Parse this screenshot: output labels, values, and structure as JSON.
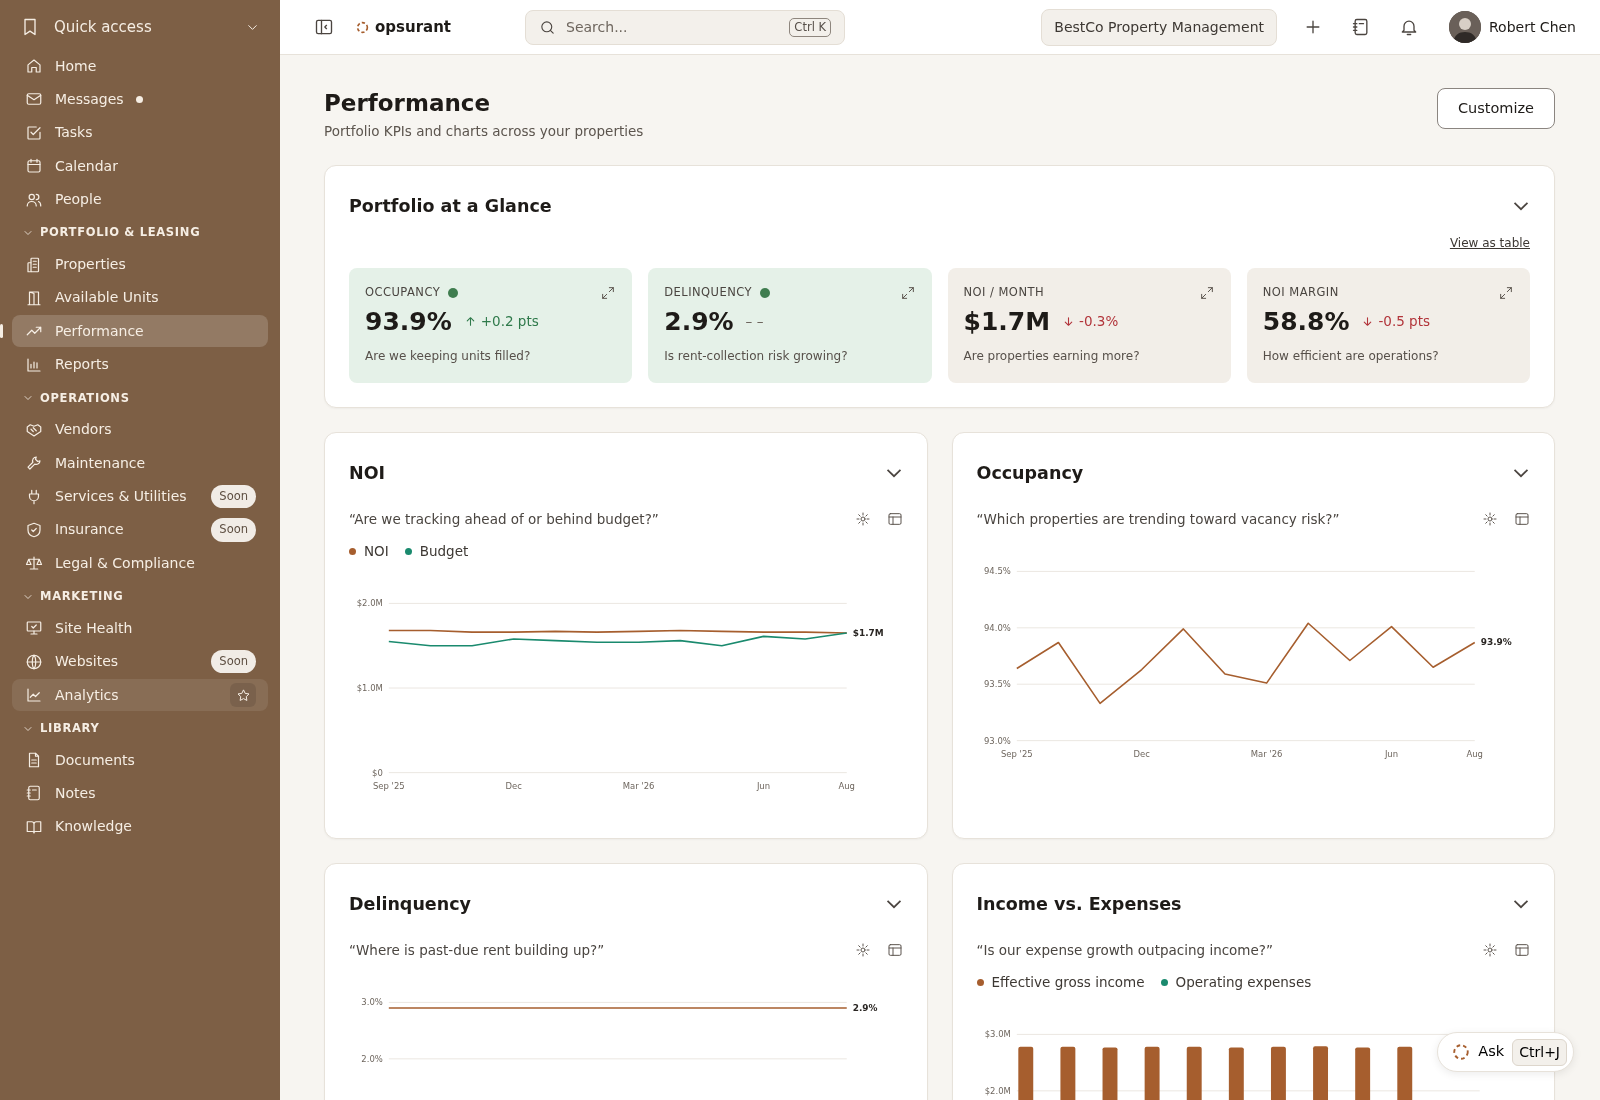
{
  "sidebar": {
    "groups": [
      {
        "kind": "quick",
        "title": "Quick access",
        "expanded": true,
        "items": [
          {
            "label": "Home",
            "selected": false
          },
          {
            "label": "Messages",
            "selected": false,
            "unread": true
          },
          {
            "label": "Tasks",
            "selected": false
          },
          {
            "label": "Calendar",
            "selected": false
          },
          {
            "label": "People",
            "selected": false
          }
        ]
      },
      {
        "kind": "section",
        "title": "PORTFOLIO & LEASING",
        "expanded": true,
        "items": [
          {
            "label": "Properties",
            "selected": false
          },
          {
            "label": "Available Units",
            "selected": false
          },
          {
            "label": "Performance",
            "selected": true
          },
          {
            "label": "Reports",
            "selected": false
          }
        ]
      },
      {
        "kind": "section",
        "title": "OPERATIONS",
        "expanded": true,
        "items": [
          {
            "label": "Vendors",
            "selected": false
          },
          {
            "label": "Maintenance",
            "selected": false
          },
          {
            "label": "Services & Utilities",
            "selected": false,
            "badge": "Soon"
          },
          {
            "label": "Insurance",
            "selected": false,
            "badge": "Soon"
          },
          {
            "label": "Legal & Compliance",
            "selected": false
          }
        ]
      },
      {
        "kind": "section",
        "title": "MARKETING",
        "expanded": true,
        "items": [
          {
            "label": "Site Health",
            "selected": false
          },
          {
            "label": "Websites",
            "selected": false,
            "badge": "Soon"
          },
          {
            "label": "Analytics",
            "selected": false,
            "hovered": true,
            "pinned": false
          }
        ]
      },
      {
        "kind": "section",
        "title": "LIBRARY",
        "expanded": true,
        "items": [
          {
            "label": "Documents",
            "selected": false
          },
          {
            "label": "Notes",
            "selected": false
          },
          {
            "label": "Knowledge",
            "selected": false
          }
        ]
      }
    ]
  },
  "topbar": {
    "brand": "opsurant",
    "search": {
      "placeholder": "Search...",
      "shortcut": "Ctrl K"
    },
    "organization": "BestCo Property Management",
    "user": {
      "name": "Robert Chen"
    }
  },
  "page": {
    "title": "Performance",
    "subtitle": "Portfolio KPIs and charts across your properties",
    "action": "Customize"
  },
  "glance": {
    "title": "Portfolio at a Glance",
    "link": "View as table",
    "kpis": [
      {
        "kind": "up",
        "label": "OCCUPANCY",
        "color": "#3f7d4f",
        "value": "93.9%",
        "change": "+0.2 pts",
        "question": "Are we keeping units filled?",
        "highlighted": true
      },
      {
        "kind": "flat",
        "label": "DELINQUENCY",
        "color": "#3f7d4f",
        "value": "2.9%",
        "change": "– –",
        "question": "Is rent-collection risk growing?",
        "highlighted": true
      },
      {
        "kind": "down",
        "label": "NOI / MONTH",
        "value": "$1.7M",
        "change": "-0.3%",
        "question": "Are properties earning more?",
        "highlighted": false
      },
      {
        "kind": "down",
        "label": "NOI MARGIN",
        "value": "58.8%",
        "change": "-0.5 pts",
        "question": "How efficient are operations?",
        "highlighted": false
      }
    ]
  },
  "panels": [
    {
      "title": "NOI",
      "question": "“Are we tracking ahead of or behind budget?”",
      "chart_data": {
        "type": "line",
        "categories": [
          "Sep '25",
          null,
          null,
          "Dec",
          null,
          null,
          "Mar '26",
          null,
          null,
          "Jun",
          null,
          "Aug"
        ],
        "ylim": [
          0,
          2.0
        ],
        "yticks": [
          {
            "value": 0,
            "label": "$0"
          },
          {
            "value": 1.0,
            "label": "$1.0M"
          },
          {
            "value": 2.0,
            "label": "$2.0M"
          }
        ],
        "series": [
          {
            "name": "NOI",
            "color": "#a65e2e",
            "values": [
              1.68,
              1.68,
              1.66,
              1.66,
              1.67,
              1.66,
              1.67,
              1.68,
              1.67,
              1.66,
              1.66,
              1.65
            ]
          },
          {
            "name": "Budget",
            "color": "#1a8a6e",
            "values": [
              1.55,
              1.5,
              1.5,
              1.58,
              1.56,
              1.54,
              1.54,
              1.56,
              1.5,
              1.61,
              1.58,
              1.65
            ]
          }
        ],
        "annotations": [
          {
            "text": "$1.7M"
          }
        ]
      }
    },
    {
      "title": "Occupancy",
      "question": "“Which properties are trending toward vacancy risk?”",
      "chart_data": {
        "type": "line",
        "categories": [
          "Sep '25",
          null,
          null,
          "Dec",
          null,
          null,
          "Mar '26",
          null,
          null,
          "Jun",
          null,
          "Aug"
        ],
        "ylim": [
          93.0,
          94.5
        ],
        "yticks": [
          {
            "value": 93.0,
            "label": "93.0%"
          },
          {
            "value": 93.5,
            "label": "93.5%"
          },
          {
            "value": 94.0,
            "label": "94.0%"
          },
          {
            "value": 94.5,
            "label": "94.5%"
          }
        ],
        "series": [
          {
            "color": "#a65e2e",
            "values": [
              93.64,
              93.87,
              93.33,
              93.63,
              93.99,
              93.59,
              93.51,
              94.04,
              93.71,
              94.01,
              93.65,
              93.87
            ]
          }
        ],
        "annotations": [
          {
            "text": "93.9%"
          }
        ]
      }
    },
    {
      "title": "Delinquency",
      "question": "“Where is past-due rent building up?”",
      "chart_data": {
        "type": "line",
        "ylim": [
          2.0,
          3.0
        ],
        "yticks": [
          {
            "value": 2.0,
            "label": "2.0%"
          },
          {
            "value": 3.0,
            "label": "3.0%"
          }
        ],
        "series": [
          {
            "color": "#a65e2e",
            "values": [
              2.9,
              2.9,
              2.9,
              2.9,
              2.9,
              2.9,
              2.9,
              2.9,
              2.9,
              2.9,
              2.9,
              2.9
            ]
          }
        ],
        "annotations": [
          {
            "text": "2.9%"
          }
        ]
      }
    },
    {
      "title": "Income vs. Expenses",
      "question": "“Is our expense growth outpacing income?”",
      "chart_data": {
        "type": "bar",
        "ylim": [
          0,
          3.0
        ],
        "yticks": [
          {
            "value": 2.0,
            "label": "$2.0M"
          },
          {
            "value": 3.0,
            "label": "$3.0M"
          }
        ],
        "series": [
          {
            "name": "Effective gross income",
            "color": "#a65e2e",
            "values": [
              2.78,
              2.78,
              2.77,
              2.78,
              2.78,
              2.77,
              2.78,
              2.79,
              2.77,
              2.78,
              null,
              null
            ]
          },
          {
            "name": "Operating expenses",
            "color": "#1a8a6e",
            "values": [
              null,
              null,
              null,
              null,
              null,
              null,
              null,
              null,
              null,
              null,
              null,
              null
            ]
          }
        ]
      }
    }
  ],
  "assistant": {
    "label": "Ask",
    "shortcut": "Ctrl+J"
  }
}
